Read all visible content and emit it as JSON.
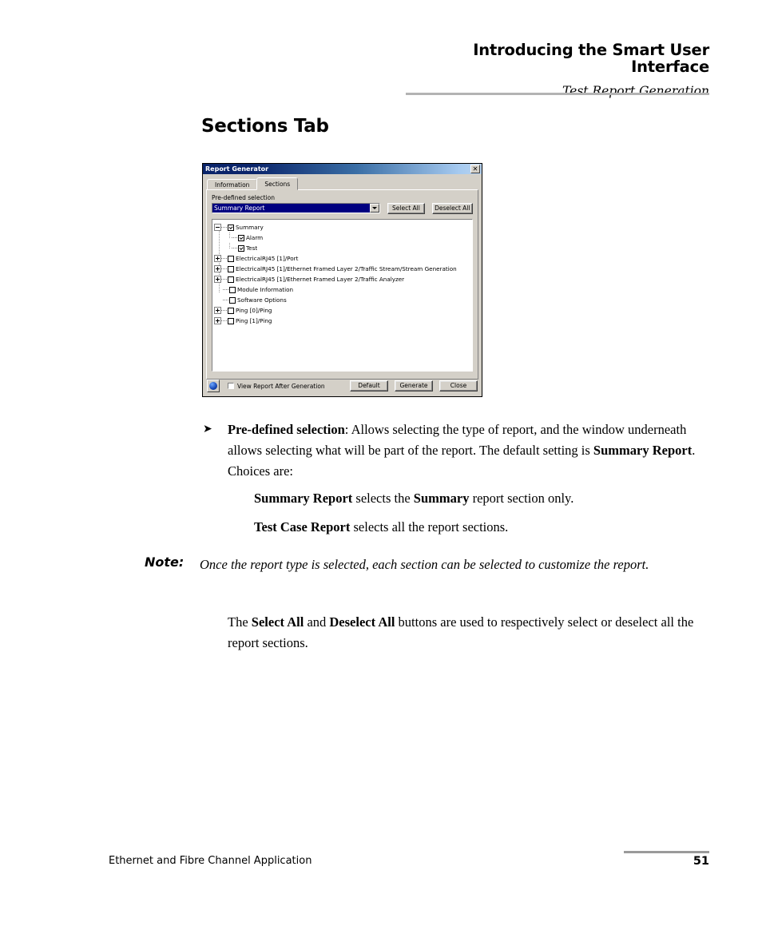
{
  "header": {
    "title": "Introducing the Smart User Interface",
    "subtitle": "Test Report Generation"
  },
  "section": {
    "title": "Sections Tab"
  },
  "dialog": {
    "title": "Report Generator",
    "close_label": "✕",
    "tabs": [
      {
        "label": "Information",
        "active": false
      },
      {
        "label": "Sections",
        "active": true
      }
    ],
    "predefined": {
      "label": "Pre-defined selection",
      "value": "Summary Report",
      "options": [
        "Summary Report",
        "Test Case Report"
      ]
    },
    "buttons": {
      "select_all": "Select All",
      "deselect_all": "Deselect All",
      "default": "Default",
      "generate": "Generate",
      "close": "Close"
    },
    "view_report_checkbox": {
      "label": "View Report After Generation",
      "checked": false
    },
    "tree": [
      {
        "label": "Summary",
        "expander": "minus",
        "checked": true,
        "indent": 0
      },
      {
        "label": "Alarm",
        "expander": "none",
        "checked": true,
        "indent": 1
      },
      {
        "label": "Test",
        "expander": "none",
        "checked": true,
        "indent": 1
      },
      {
        "label": "ElectricalRJ45 [1]/Port",
        "expander": "plus",
        "checked": false,
        "indent": 0
      },
      {
        "label": "ElectricalRJ45 [1]/Ethernet Framed Layer 2/Traffic Stream/Stream Generation",
        "expander": "plus",
        "checked": false,
        "indent": 0
      },
      {
        "label": "ElectricalRJ45 [1]/Ethernet Framed Layer 2/Traffic Analyzer",
        "expander": "plus",
        "checked": false,
        "indent": 0
      },
      {
        "label": "Module Information",
        "expander": "none-root",
        "checked": false,
        "indent": 0
      },
      {
        "label": "Software Options",
        "expander": "none-root",
        "checked": false,
        "indent": 0
      },
      {
        "label": "Ping [0]/Ping",
        "expander": "plus",
        "checked": false,
        "indent": 0
      },
      {
        "label": "Ping [1]/Ping",
        "expander": "plus",
        "checked": false,
        "indent": 0
      }
    ]
  },
  "body": {
    "bullet_arrow": "➤",
    "bullet_bold": "Pre-defined selection",
    "bullet_text_1": ": Allows selecting the type of report, and the window underneath allows selecting what will be part of the report. The default setting is ",
    "bullet_bold_2": "Summary Report",
    "bullet_text_2": ". Choices are:",
    "summary_bold": "Summary Report",
    "summary_mid": " selects the ",
    "summary_bold_2": "Summary",
    "summary_end": " report section only.",
    "testcase_bold": "Test Case Report",
    "testcase_text": " selects all the report sections.",
    "note_label": "Note:",
    "note_text": "Once the report type is selected, each section can be selected to customize the report.",
    "selectall_pre": "The ",
    "selectall_bold": "Select All",
    "selectall_mid": " and ",
    "selectall_bold_2": "Deselect All",
    "selectall_post": " buttons are used to respectively select or deselect all the report sections."
  },
  "footer": {
    "document_title": "Ethernet and Fibre Channel Application",
    "page_number": "51"
  },
  "colors": {
    "titlebar_start": "#0a246a",
    "titlebar_end": "#b9d4f0",
    "dialog_face": "#d4d0c8",
    "combo_selected": "#000080",
    "rule_gray": "#b3b3b3"
  }
}
